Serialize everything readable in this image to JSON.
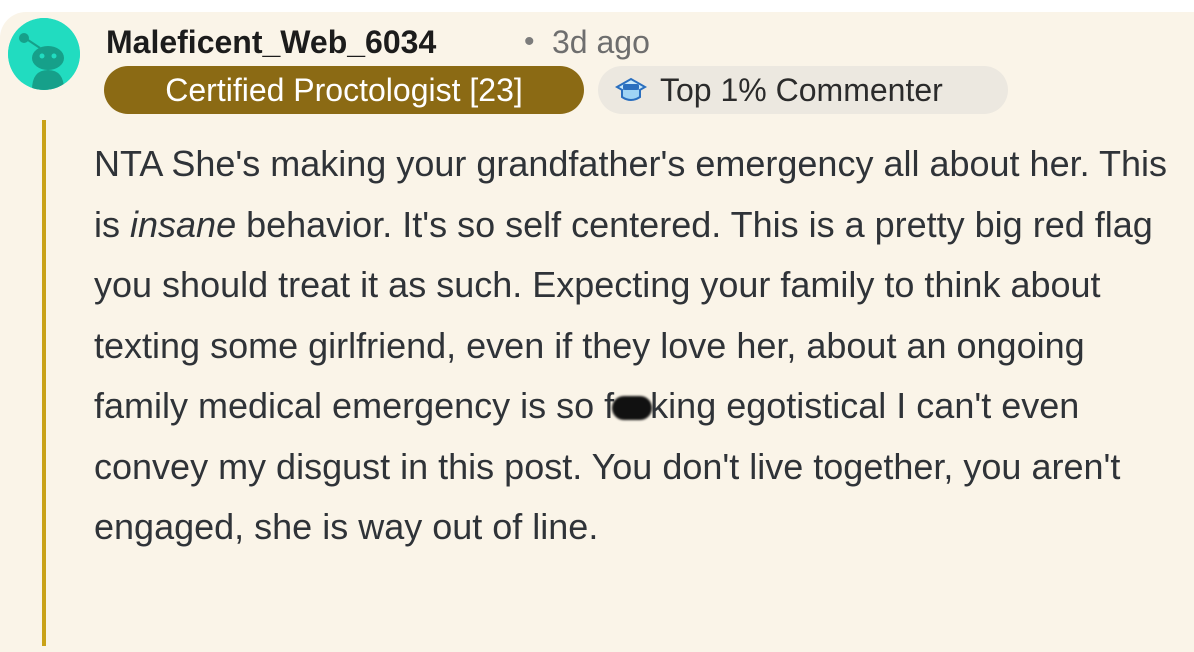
{
  "comment": {
    "author": "Maleficent_Web_6034",
    "separator": "•",
    "age": "3d ago",
    "user_flair": "Certified Proctologist [23]",
    "badge": {
      "label": "Top 1% Commenter",
      "icon": "top-commenter-icon"
    },
    "avatar_icon": "snoo-avatar-icon",
    "body": {
      "part1": "NTA She's making your grandfather's emergency all about her. This is ",
      "emphasis": "insane",
      "part2": " behavior. It's so self centered. This is a pretty big red flag you should treat it as such. Expecting your family to think about texting some girlfriend, even if they love her, about an ongoing family medical emergency is so f",
      "censored_icon": "censor-blur",
      "part3": "king egotistical I can't even convey my disgust in this post. You don't live together, you aren't engaged, she is way out of line."
    }
  },
  "colors": {
    "card_background": "#faf4e8",
    "thread_rail": "#c9a218",
    "flair_background": "#8b6a14",
    "avatar": "#21dcc0",
    "badge_background": "#ece8e0"
  }
}
